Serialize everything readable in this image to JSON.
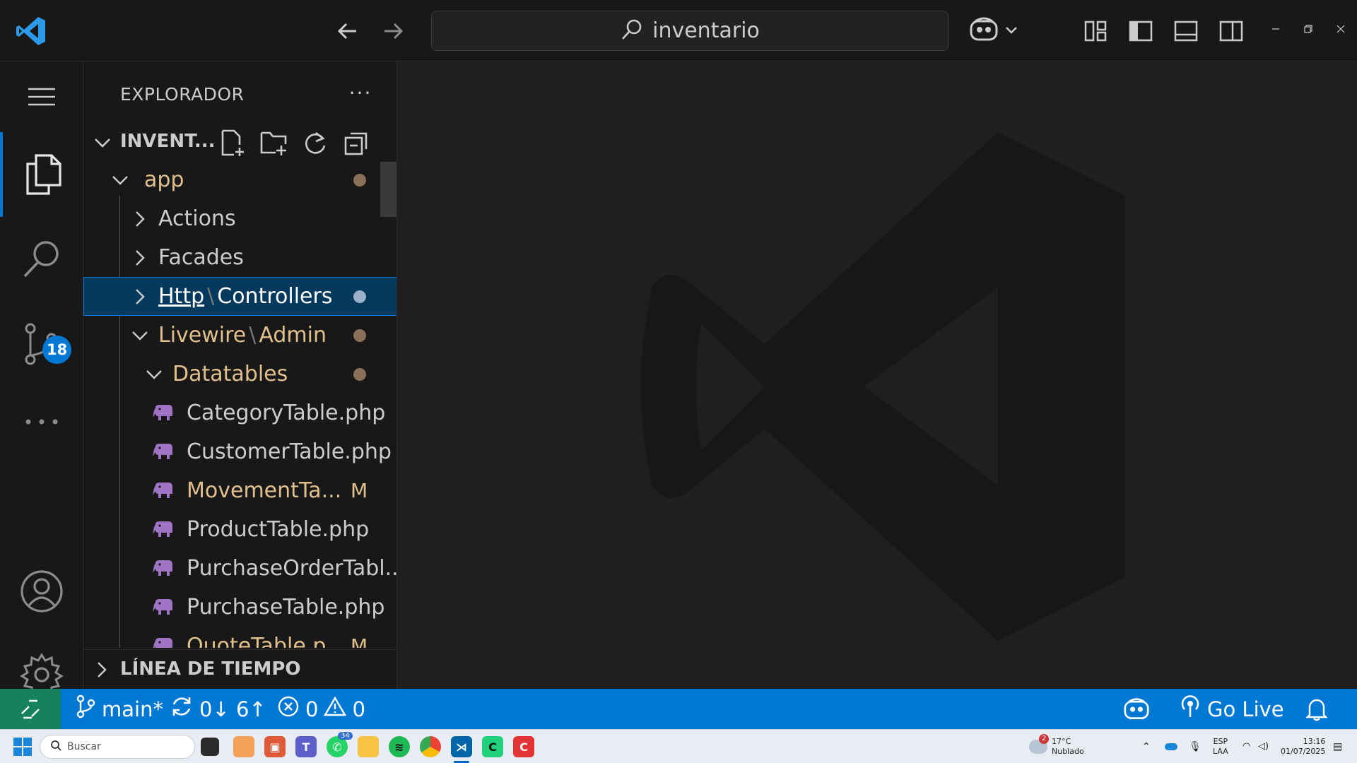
{
  "titlebar": {
    "search_text": "inventario"
  },
  "activitybar": {
    "scm_badge": "18"
  },
  "sidebar": {
    "title": "EXPLORADOR",
    "more": "···",
    "workspace": "INVENT...",
    "timeline": "LÍNEA DE TIEMPO"
  },
  "tree": {
    "app": "app",
    "actions": "Actions",
    "facades": "Facades",
    "http": "Http",
    "controllers": "Controllers",
    "livewire": "Livewire",
    "admin": "Admin",
    "path_sep": "\\",
    "datatables": "Datatables",
    "files": [
      {
        "name": "CategoryTable.php",
        "badge": ""
      },
      {
        "name": "CustomerTable.php",
        "badge": ""
      },
      {
        "name": "MovementTa...",
        "badge": "M"
      },
      {
        "name": "ProductTable.php",
        "badge": ""
      },
      {
        "name": "PurchaseOrderTabl...",
        "badge": ""
      },
      {
        "name": "PurchaseTable.php",
        "badge": ""
      },
      {
        "name": "QuoteTable.p...",
        "badge": "M"
      }
    ]
  },
  "statusbar": {
    "branch": "main*",
    "sync": "0↓ 6↑",
    "errors": "0",
    "warnings": "0",
    "go_live": "Go Live"
  },
  "taskbar": {
    "search_placeholder": "Buscar",
    "weather_temp": "17°C",
    "weather_desc": "Nublado",
    "weather_badge": "2",
    "teams_badge": "34",
    "lang_1": "ESP",
    "lang_2": "LAA",
    "time": "13:16",
    "date": "01/07/2025"
  },
  "colors": {
    "accent": "#0078d4",
    "git_modified": "#e2c08d",
    "remote": "#16825d",
    "php_icon": "#a074c4"
  }
}
